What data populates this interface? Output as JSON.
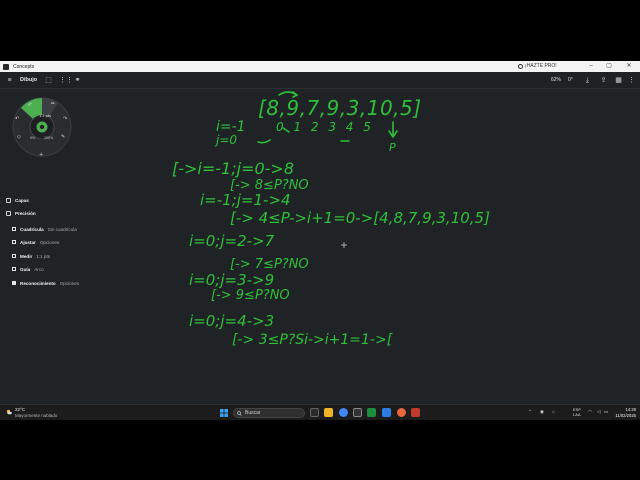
{
  "window": {
    "app_name": "Concepts",
    "pro_label": "¡HAZTE PRO!",
    "minimize": "–",
    "maximize": "▢",
    "close": "✕"
  },
  "toolbar": {
    "layer_label": "Dibujo",
    "zoom": "62%",
    "angle": "0°"
  },
  "tool_wheel": {
    "brush_size": "1.2 pts",
    "opacity_left": "0%",
    "opacity_right": "100%",
    "accent": "#4caf50"
  },
  "panel": {
    "layers": "Capas",
    "precision": "Precisión",
    "rows": [
      {
        "label": "Cuadrícula",
        "value": "Sin cuadrícula",
        "checked": false
      },
      {
        "label": "Ajustar",
        "value": "Opciones",
        "checked": false
      },
      {
        "label": "Medir",
        "value": "1:1 pts",
        "checked": false
      },
      {
        "label": "Guía",
        "value": "Arco",
        "checked": false
      },
      {
        "label": "Reconocimiento",
        "value": "Opciones",
        "checked": true
      }
    ]
  },
  "taskbar": {
    "temperature": "22°C",
    "weather": "Mayormente nublado",
    "search_placeholder": "Buscar",
    "lang": "ESP",
    "region": "LAA",
    "time": "14:28",
    "date": "11/02/2025"
  },
  "handwriting": {
    "ink_color": "#2fbf3a",
    "lines": [
      "i=-1",
      "j=0",
      "[8,9,7,9,3,10,5]",
      "0 1 2 3 4 5",
      "P",
      "[->i=-1;j=0->8",
      "[-> 8≤P?NO",
      "i=-1;j=1->4",
      "[-> 4≤P->i+1=0->[4,8,7,9,3,10,5]",
      "i=0;j=2->7",
      "[-> 7≤P?NO",
      "i=0;j=3->9",
      "[-> 9≤P?NO",
      "i=0;j=4->3",
      "[-> 3≤P?Si->i+1=1->["
    ]
  }
}
